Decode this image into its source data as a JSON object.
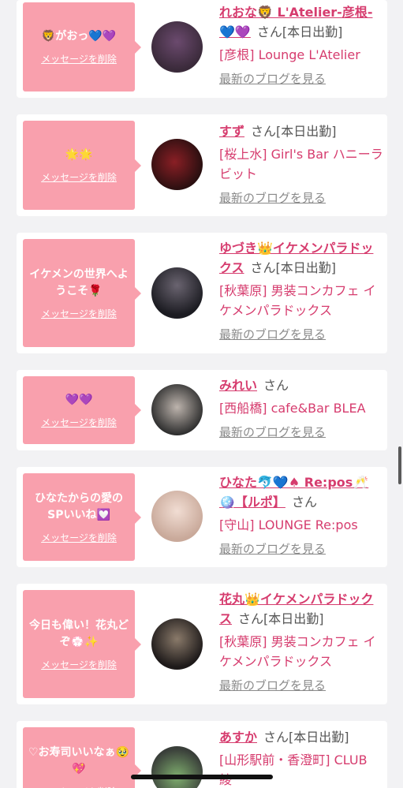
{
  "delete_label": "メッセージを削除",
  "blog_label": "最新のブログを見る",
  "san": "さん",
  "cards": [
    {
      "message": "🦁がおっ💙💜",
      "name": "れおな🦁 L'Atelier-彦根-💙💜",
      "status": "[本日出勤]",
      "shop": "[彦根] Lounge L'Atelier",
      "avatar_colors": [
        "#3a2a3a",
        "#6b4a6e"
      ]
    },
    {
      "message": "🌟🌟",
      "name": "すず",
      "status": "[本日出勤]",
      "shop": "[桜上水] Girl's Bar ハニーラビット",
      "avatar_colors": [
        "#2a0f10",
        "#8a1f25"
      ]
    },
    {
      "message": "イケメンの世界へようこそ🌹",
      "name": "ゆづき👑イケメンパラドックス",
      "status": "[本日出勤]",
      "shop": "[秋葉原] 男装コンカフェ イケメンパラドックス",
      "avatar_colors": [
        "#1c1c22",
        "#6a6470"
      ]
    },
    {
      "message": "💜💜",
      "name": "みれい",
      "status": "",
      "shop": "[西船橋] cafe&Bar BLEA",
      "avatar_colors": [
        "#2e2e2e",
        "#bdb4ad"
      ]
    },
    {
      "message": "ひなたからの愛のSPいいね💟",
      "name": "ひなた🐬💙♠ Re:pos🥂🪩【ルポ】",
      "status": "",
      "shop": "[守山] LOUNGE Re:pos",
      "avatar_colors": [
        "#c9a99a",
        "#f1ddd3"
      ]
    },
    {
      "message": "今日も偉い！花丸どぞ💮✨",
      "name": "花丸👑イケメンパラドックス",
      "status": "[本日出勤]",
      "shop": "[秋葉原] 男装コンカフェ イケメンパラドックス",
      "avatar_colors": [
        "#1e1a1a",
        "#8a7a6a"
      ]
    },
    {
      "message": "♡お寿司いいなぁ🥹💖",
      "name": "あすか",
      "status": "[本日出勤]",
      "shop": "[山形駅前・香澄町] CLUB 綾",
      "avatar_colors": [
        "#3a3f3a",
        "#7fae6e"
      ]
    }
  ]
}
